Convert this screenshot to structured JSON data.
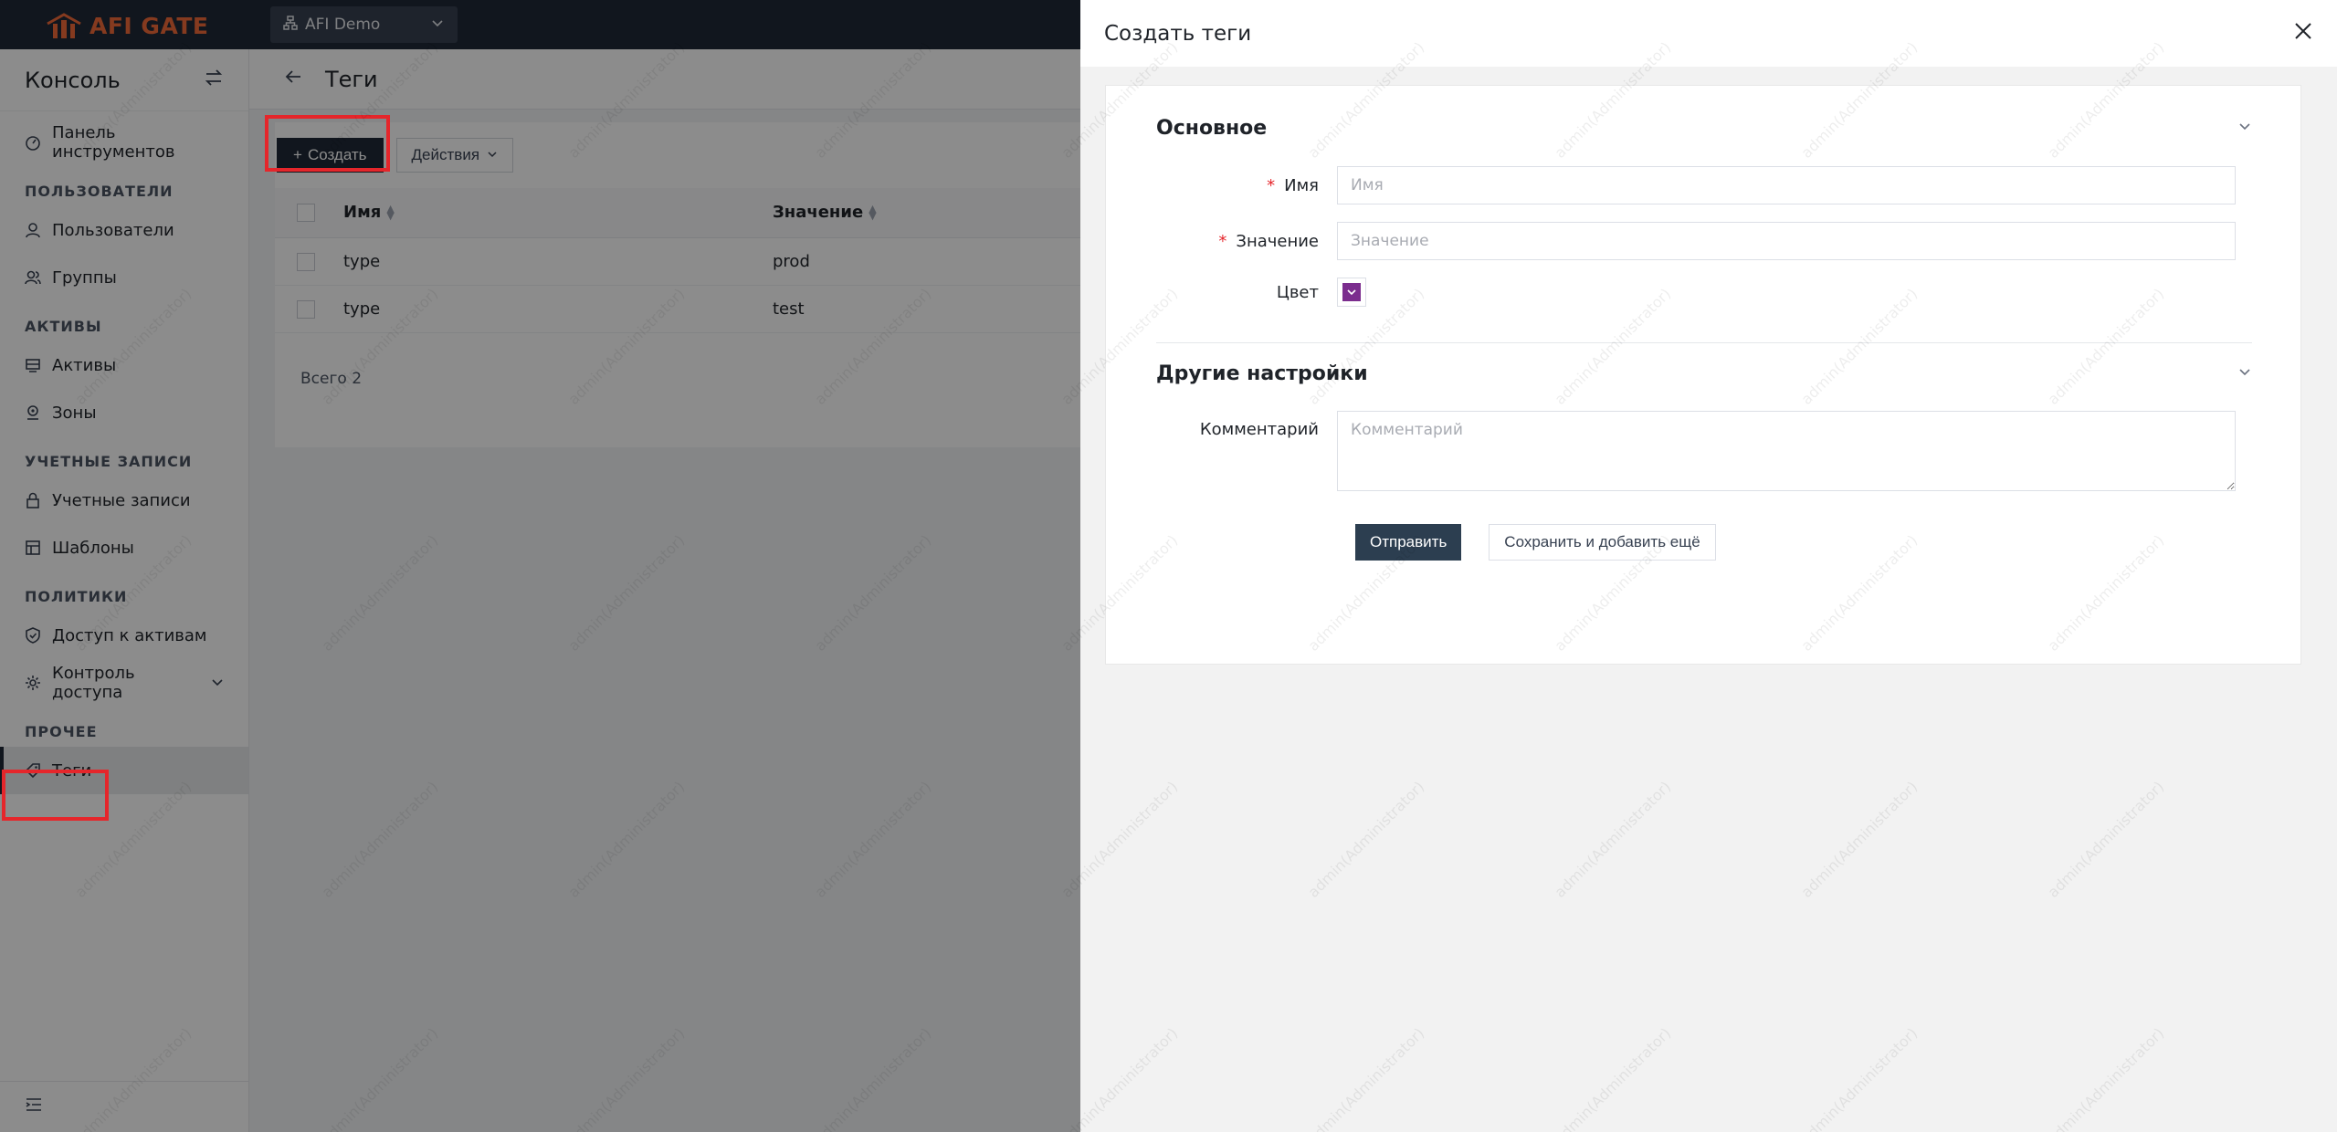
{
  "topbar": {
    "logo_text": "AFI GATE",
    "org_label": "AFI Demo"
  },
  "sidebar": {
    "title": "Консоль",
    "items": {
      "dashboard": "Панель инструментов",
      "group_users": "ПОЛЬЗОВАТЕЛИ",
      "users": "Пользователи",
      "groups": "Группы",
      "group_assets": "АКТИВЫ",
      "assets": "Активы",
      "zones": "Зоны",
      "group_accounts": "УЧЕТНЫЕ ЗАПИСИ",
      "accounts": "Учетные записи",
      "templates": "Шаблоны",
      "group_policies": "ПОЛИТИКИ",
      "asset_access": "Доступ к активам",
      "access_control": "Контроль доступа",
      "group_other": "ПРОЧЕЕ",
      "tags": "Теги"
    }
  },
  "main": {
    "page_title": "Теги",
    "create_label": "Создать",
    "actions_label": "Действия",
    "columns": {
      "name": "Имя",
      "value": "Значение"
    },
    "rows": [
      {
        "name": "type",
        "value": "prod"
      },
      {
        "name": "type",
        "value": "test"
      }
    ],
    "total": "Всего 2"
  },
  "drawer": {
    "title": "Создать теги",
    "section_basic": "Основное",
    "name_label": "Имя",
    "name_placeholder": "Имя",
    "value_label": "Значение",
    "value_placeholder": "Значение",
    "color_label": "Цвет",
    "color_value": "#7b2d8e",
    "section_other": "Другие настройки",
    "comment_label": "Комментарий",
    "comment_placeholder": "Комментарий",
    "submit_label": "Отправить",
    "save_add_label": "Сохранить и добавить ещё"
  },
  "watermark": "admin(Administrator)"
}
